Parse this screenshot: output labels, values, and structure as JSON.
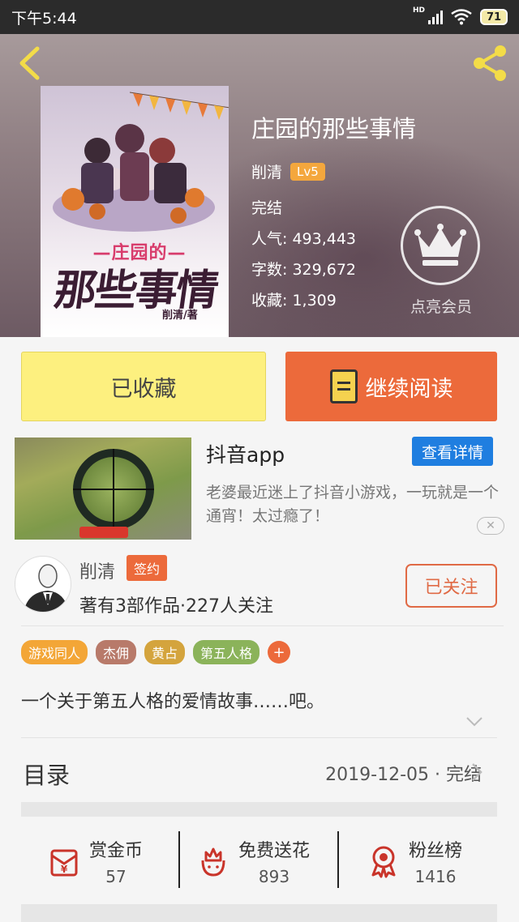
{
  "status_bar": {
    "time": "下午5:44",
    "network": "HD",
    "battery": "71"
  },
  "book": {
    "title": "庄园的那些事情",
    "author": "削清",
    "level": "Lv5",
    "status": "完结",
    "popularity": "人气: 493,443",
    "word_count": "字数: 329,672",
    "favorites": "收藏: 1,309",
    "vip_label": "点亮会员"
  },
  "cover": {
    "subtitle": "—庄园的—",
    "title": "那些事情",
    "author_mark": "削清/著"
  },
  "actions": {
    "favorite_label": "已收藏",
    "read_label": "继续阅读"
  },
  "ad": {
    "title": "抖音app",
    "detail_button": "查看详情",
    "description": "老婆最近迷上了抖音小游戏，一玩就是一个通宵！太过瘾了！",
    "close": "✕"
  },
  "author_card": {
    "name": "削清",
    "badge": "签约",
    "stats": "著有3部作品·227人关注",
    "follow_label": "已关注"
  },
  "tags": [
    {
      "label": "游戏同人",
      "color": "#f3a637"
    },
    {
      "label": "杰佣",
      "color": "#b87a6a"
    },
    {
      "label": "黄占",
      "color": "#d4a43d"
    },
    {
      "label": "第五人格",
      "color": "#8bb35a"
    }
  ],
  "tag_add": "+",
  "summary": "一个关于第五人格的爱情故事……吧。",
  "toc": {
    "label": "目录",
    "meta": "2019-12-05 · 完结"
  },
  "bottom_stats": [
    {
      "label": "赏金币",
      "value": "57",
      "icon": "coin-envelope-icon"
    },
    {
      "label": "免费送花",
      "value": "893",
      "icon": "flower-icon"
    },
    {
      "label": "粉丝榜",
      "value": "1416",
      "icon": "medal-icon"
    }
  ],
  "colors": {
    "accent": "#ec6a3b",
    "favorite_bg": "#fdf07f",
    "ad_button": "#1f7ee0"
  }
}
